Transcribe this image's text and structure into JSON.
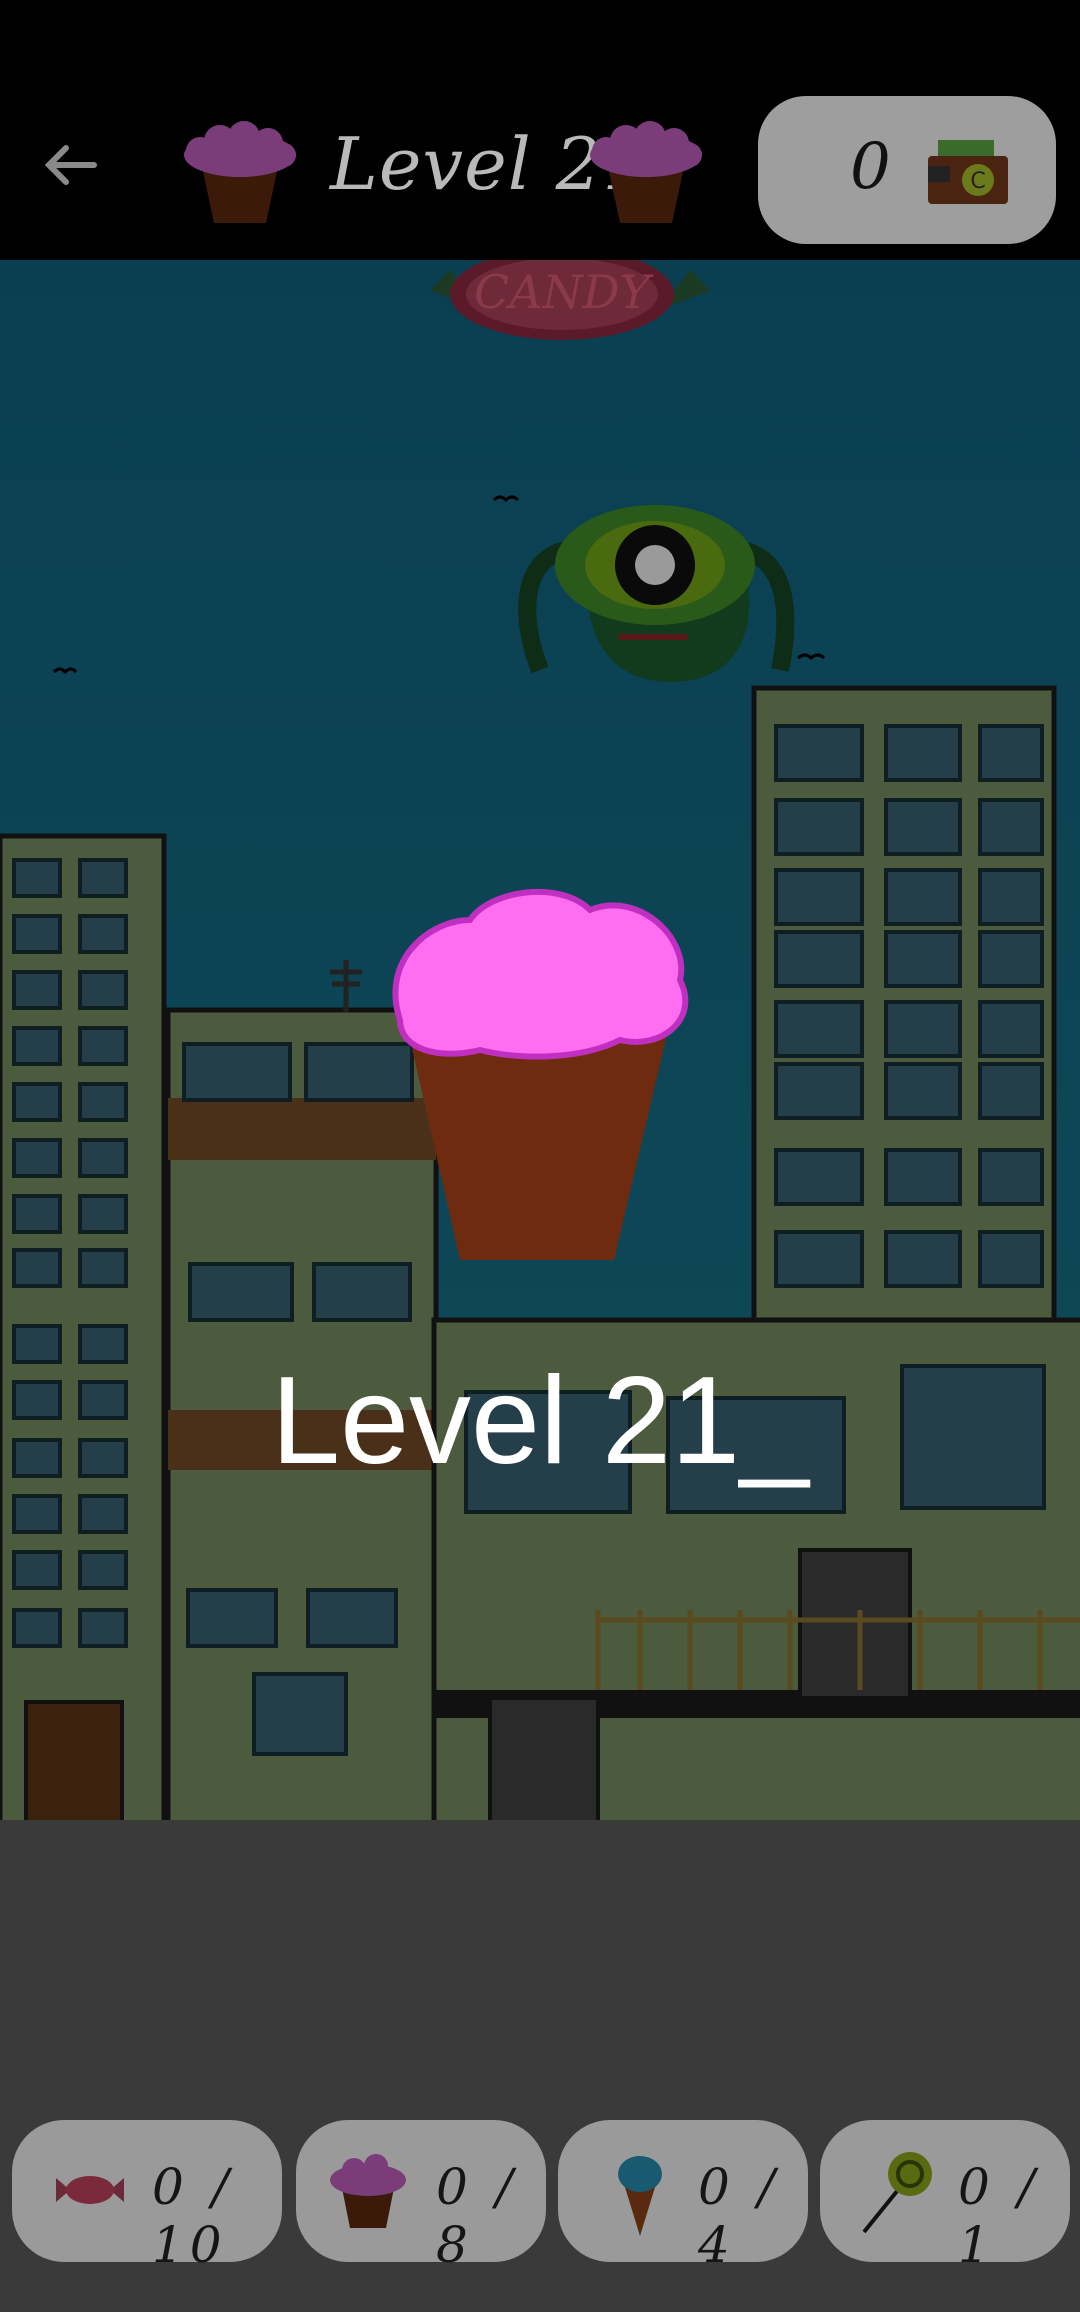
{
  "header": {
    "level_title": "Level 21",
    "coins": "0",
    "back_icon": "arrow-left-icon",
    "wallet_icon": "wallet-icon"
  },
  "scene": {
    "level_banner": "Level 21_",
    "sign_text": "CANDY"
  },
  "goals": [
    {
      "icon": "wrapped-candy-icon",
      "progress": "0 / 10"
    },
    {
      "icon": "cupcake-icon",
      "progress": "0 / 8"
    },
    {
      "icon": "ice-cream-cone-icon",
      "progress": "0 / 4"
    },
    {
      "icon": "lollipop-icon",
      "progress": "0 / 1"
    }
  ],
  "colors": {
    "sky": "#0d4a5c",
    "building": "#4a5b3c",
    "frosting": "#ff6ef0",
    "cake": "#6e2b10"
  }
}
